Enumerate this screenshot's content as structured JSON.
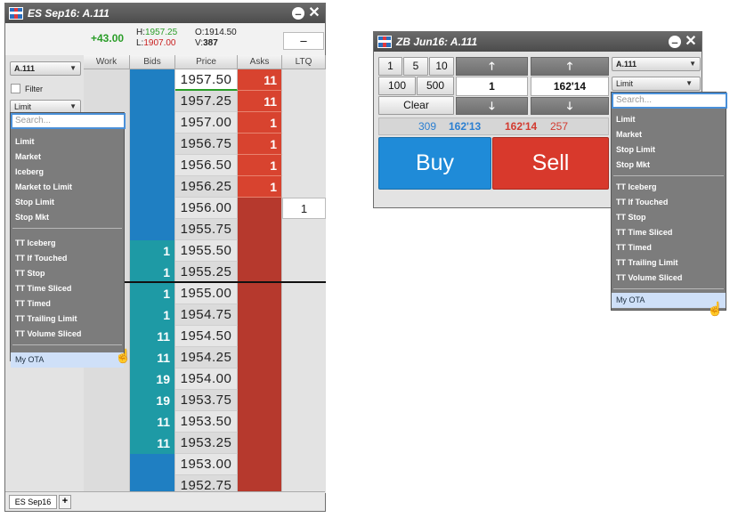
{
  "ladder_window": {
    "title": "ES Sep16: A.111",
    "pnl": "+43.00",
    "high_label": "H:",
    "high": "1957.25",
    "low_label": "L:",
    "low": "1907.00",
    "open_label": "O:",
    "open": "1914.50",
    "volume_label": "V:",
    "volume": "387",
    "dash_button": "–",
    "account": "A.111",
    "filter_label": "Filter",
    "order_type": "Limit",
    "columns": [
      "Work",
      "Bids",
      "Price",
      "Asks",
      "LTQ"
    ],
    "rows": [
      {
        "price": "1957.50",
        "bid": "",
        "ask": "11",
        "ltq": ""
      },
      {
        "price": "1957.25",
        "bid": "",
        "ask": "11",
        "ltq": ""
      },
      {
        "price": "1957.00",
        "bid": "",
        "ask": "1",
        "ltq": ""
      },
      {
        "price": "1956.75",
        "bid": "",
        "ask": "1",
        "ltq": ""
      },
      {
        "price": "1956.50",
        "bid": "",
        "ask": "1",
        "ltq": ""
      },
      {
        "price": "1956.25",
        "bid": "",
        "ask": "1",
        "ltq": ""
      },
      {
        "price": "1956.00",
        "bid": "",
        "ask": "",
        "ltq": "1"
      },
      {
        "price": "1955.75",
        "bid": "",
        "ask": "",
        "ltq": ""
      },
      {
        "price": "1955.50",
        "bid": "1",
        "ask": "",
        "ltq": ""
      },
      {
        "price": "1955.25",
        "bid": "1",
        "ask": "",
        "ltq": ""
      },
      {
        "price": "1955.00",
        "bid": "1",
        "ask": "",
        "ltq": ""
      },
      {
        "price": "1954.75",
        "bid": "1",
        "ask": "",
        "ltq": ""
      },
      {
        "price": "1954.50",
        "bid": "11",
        "ask": "",
        "ltq": ""
      },
      {
        "price": "1954.25",
        "bid": "11",
        "ask": "",
        "ltq": ""
      },
      {
        "price": "1954.00",
        "bid": "19",
        "ask": "",
        "ltq": ""
      },
      {
        "price": "1953.75",
        "bid": "19",
        "ask": "",
        "ltq": ""
      },
      {
        "price": "1953.50",
        "bid": "11",
        "ask": "",
        "ltq": ""
      },
      {
        "price": "1953.25",
        "bid": "11",
        "ask": "",
        "ltq": ""
      },
      {
        "price": "1953.00",
        "bid": "",
        "ask": "",
        "ltq": ""
      },
      {
        "price": "1952.75",
        "bid": "",
        "ask": "",
        "ltq": ""
      }
    ],
    "footer_tab": "ES Sep16",
    "footer_add": "+",
    "colors": {
      "bid": "#1f7fc2",
      "bid_filled": "#1e9aa5",
      "ask": "#d8432f",
      "ask_dark": "#b6392d"
    }
  },
  "ladder_dropdown": {
    "search_placeholder": "Search...",
    "group1": [
      "Limit",
      "Market",
      "Iceberg",
      "Market to Limit",
      "Stop Limit",
      "Stop Mkt"
    ],
    "group2": [
      "TT Iceberg",
      "TT If Touched",
      "TT Stop",
      "TT Time Sliced",
      "TT Timed",
      "TT Trailing Limit",
      "TT Volume Sliced"
    ],
    "highlighted": "My OTA"
  },
  "ticket_window": {
    "title": "ZB Jun16: A.111",
    "qty_buttons": [
      "1",
      "5",
      "10",
      "100",
      "500"
    ],
    "clear": "Clear",
    "qty_value": "1",
    "price_value": "162'14",
    "account": "A.111",
    "order_type": "Limit",
    "bid_qty": "309",
    "bid_price": "162'13",
    "ask_price": "162'14",
    "ask_qty": "257",
    "buy": "Buy",
    "sell": "Sell",
    "colors": {
      "buy": "#1f8bd8",
      "sell": "#d8392c"
    }
  },
  "ticket_dropdown": {
    "search_placeholder": "Search...",
    "group1": [
      "Limit",
      "Market",
      "Stop Limit",
      "Stop Mkt"
    ],
    "group2": [
      "TT Iceberg",
      "TT If Touched",
      "TT Stop",
      "TT Time Sliced",
      "TT Timed",
      "TT Trailing Limit",
      "TT Volume Sliced"
    ],
    "highlighted": "My OTA"
  }
}
